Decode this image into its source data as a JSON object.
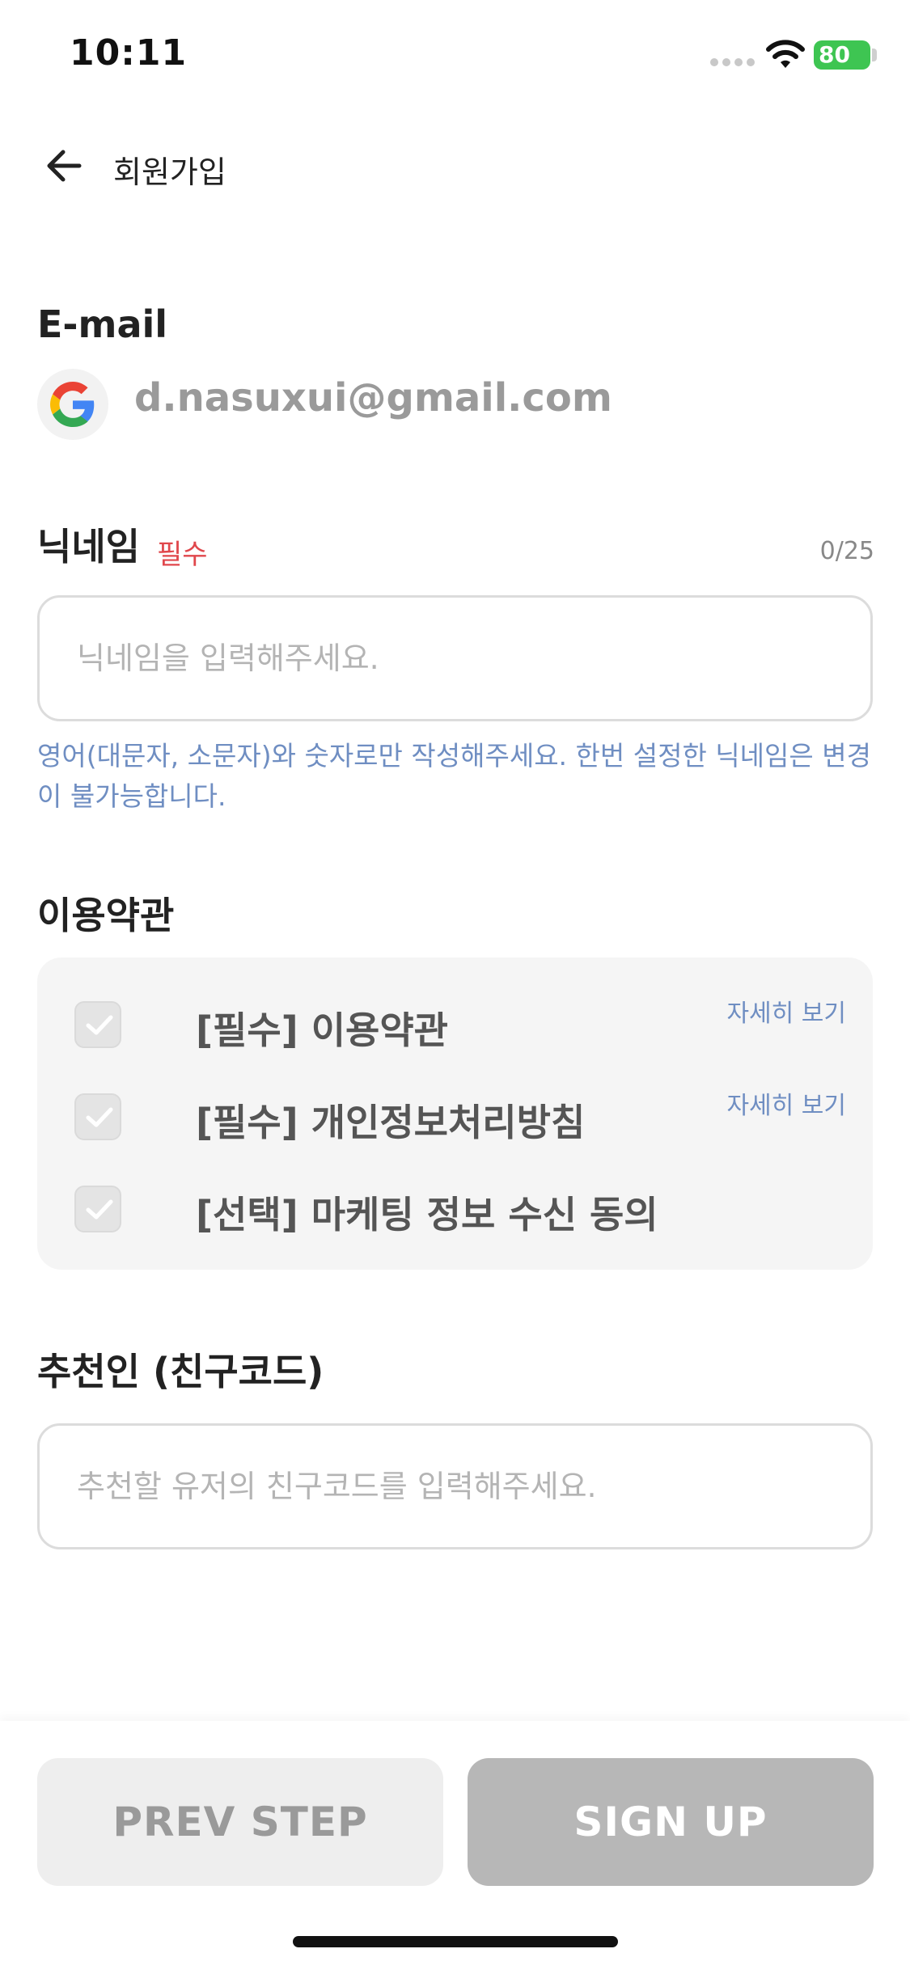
{
  "status_bar": {
    "time": "10:11",
    "battery": "80"
  },
  "header": {
    "title": "회원가입"
  },
  "email": {
    "label": "E-mail",
    "value": "d.nasuxui@gmail.com"
  },
  "nickname": {
    "label": "닉네임",
    "required": "필수",
    "count": "0/25",
    "placeholder": "닉네임을 입력해주세요.",
    "hint": "영어(대문자, 소문자)와 숫자로만 작성해주세요. 한번 설정한 닉네임은 변경이 불가능합니다."
  },
  "terms": {
    "label": "이용약관",
    "items": [
      {
        "label": "[필수] 이용약관",
        "detail": "자세히 보기"
      },
      {
        "label": "[필수] 개인정보처리방침",
        "detail": "자세히 보기"
      },
      {
        "label": "[선택] 마케팅 정보 수신 동의"
      }
    ]
  },
  "referral": {
    "label": "추천인 (친구코드)",
    "placeholder": "추천할 유저의 친구코드를 입력해주세요."
  },
  "buttons": {
    "prev": "PREV STEP",
    "signup": "SIGN UP"
  },
  "colors": {
    "required": "#e0474c",
    "hint": "#6f8ec2",
    "battery": "#3ec552"
  }
}
